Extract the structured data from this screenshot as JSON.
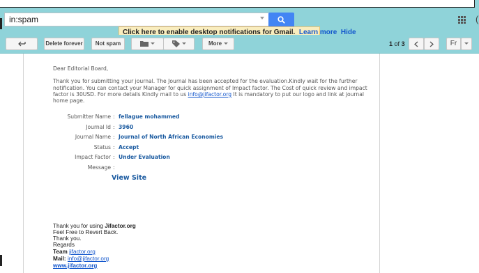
{
  "search": {
    "value": "in:spam",
    "button_label": "search"
  },
  "notification": {
    "enable_link": "Click here to enable",
    "text": " desktop notifications for Gmail.",
    "learn_more": "Learn more",
    "hide": "Hide"
  },
  "toolbar": {
    "back_label": "back",
    "delete_forever": "Delete forever",
    "not_spam": "Not spam",
    "more": "More",
    "pager_range": "1",
    "pager_of": "of",
    "pager_total": "3",
    "font_label": "Fr"
  },
  "email": {
    "greeting": "Dear Editorial Board,",
    "para_line1": "Thank you for submitting your journal. The Journal has been accepted for the evaluation.Kindly wait for the further",
    "para_line2": "notification. You can contact your Manager for quick assignment of Impact factor. The Cost of quick review and impact",
    "para_line3_pre": "factor is 30USD. For more details Kindly mail to us ",
    "para_line3_link": "info@jifactor.org",
    "para_line3_post": " It is mandatory to put our logo and link at journal",
    "para_line4": "home page.",
    "fields": [
      {
        "label": "Submitter Name",
        "value": "fellague mohammed"
      },
      {
        "label": "Journal Id",
        "value": "3960"
      },
      {
        "label": "Journal Name",
        "value": "Journal of North African Economies"
      },
      {
        "label": "Status",
        "value": "Accept"
      },
      {
        "label": "Impact Factor",
        "value": "Under Evaluation"
      },
      {
        "label": "Message",
        "value": ""
      }
    ],
    "view_site": "View Site",
    "sig_line1_pre": "Thank you for using ",
    "sig_line1_bold": "Jifactor.org",
    "sig_line2": "Feel Free to Revert Back.",
    "sig_line3": "Thank you.",
    "sig_line4": "Regards",
    "sig_team_label": "Team ",
    "sig_team_link": "jifactor.org",
    "sig_mail_label": "Mail: ",
    "sig_mail_link": "info@jifactor.org",
    "sig_www": "www.jifactor.org"
  }
}
